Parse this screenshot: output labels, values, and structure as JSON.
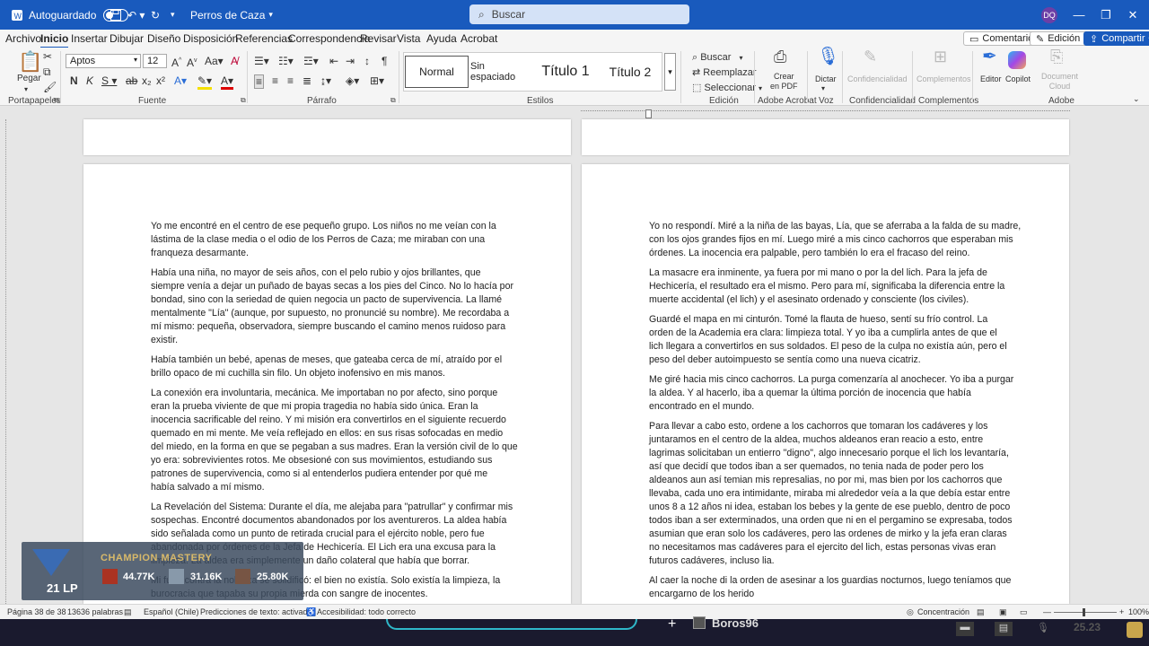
{
  "titlebar": {
    "autosave_label": "Autoguardado",
    "doc_title": "Perros de Caza",
    "search_placeholder": "Buscar",
    "user_initials": "DQ"
  },
  "menu": {
    "tabs": [
      "Archivo",
      "Inicio",
      "Insertar",
      "Dibujar",
      "Diseño",
      "Disposición",
      "Referencias",
      "Correspondencia",
      "Revisar",
      "Vista",
      "Ayuda",
      "Acrobat"
    ],
    "comments": "Comentarios",
    "edit_mode": "Edición",
    "share": "Compartir"
  },
  "ribbon": {
    "paste_label": "Pegar",
    "font_name": "Aptos",
    "font_size": "12",
    "styles": [
      "Normal",
      "Sin espaciado",
      "Título 1",
      "Título 2"
    ],
    "find": "Buscar",
    "replace": "Reemplazar",
    "select": "Seleccionar",
    "create_pdf": "Crear en PDF",
    "create_pdf_line1": "Crear",
    "create_pdf_line2": "en PDF",
    "dictate": "Dictar",
    "confidentiality": "Confidencialidad",
    "complements": "Complementos",
    "editor": "Editor",
    "copilot": "Copilot",
    "cloud_doc_line1": "Document",
    "cloud_doc_line2": "Cloud",
    "groups": {
      "clipboard": "Portapapeles",
      "font": "Fuente",
      "paragraph": "Párrafo",
      "styles": "Estilos",
      "editing": "Edición",
      "adobe": "Adobe Acrobat",
      "voice": "Voz",
      "confidentiality": "Confidencialidad",
      "complements": "Complementos",
      "adobe2": "Adobe"
    }
  },
  "left_page": {
    "paragraphs": [
      [
        "Yo me encontré en el centro de ese pequeño grupo. Los niños no me veían con la",
        "lástima de la clase media o el odio de los Perros de Caza; me miraban con una",
        "franqueza desarmante."
      ],
      [
        "Había una niña, no mayor de seis años, con el pelo rubio y ojos brillantes, que",
        "siempre venía a dejar un puñado de bayas secas a los pies del Cinco. No lo hacía por",
        "bondad, sino con la seriedad de quien negocia un pacto de supervivencia. La llamé",
        "mentalmente \"Lía\" (aunque, por supuesto, no pronuncié su nombre). Me recordaba a",
        "mí mismo: pequeña, observadora, siempre buscando el camino menos ruidoso para",
        "existir."
      ],
      [
        "Había también un bebé, apenas de meses, que gateaba cerca de mí, atraído por el",
        "brillo opaco de mi cuchilla sin filo. Un objeto inofensivo en mis manos."
      ],
      [
        "La conexión era involuntaria, mecánica. Me importaban no por afecto, sino porque",
        "eran la prueba viviente de que mi propia tragedia no había sido única. Eran la",
        "inocencia sacrificable del reino. Y mi misión era convertirlos en el siguiente recuerdo",
        "quemado en mi mente. Me veía reflejado en ellos: en sus risas sofocadas en medio",
        "del miedo, en la forma en que se pegaban a sus madres. Eran la versión civil de lo que",
        "yo era: sobrevivientes rotos. Me obsesioné con sus movimientos, estudiando sus",
        "patrones de supervivencia, como si al entenderlos pudiera entender por qué me",
        "había salvado a mí mismo."
      ],
      [
        "La Revelación del Sistema: Durante el día, me alejaba para \"patrullar\" y confirmar mis",
        "sospechas. Encontré documentos abandonados por los aventureros. La aldea había",
        "sido señalada como un punto de retirada crucial para el ejército noble, pero fue",
        "abandonada por órdenes de la Jefa de Hechicería. El Lich era una excusa para la",
        "limpieza. La aldea era simplemente un daño colateral que había que borrar."
      ],
      [
        "Mi furia contra la nobleza se solidificó: el bien no existía. Solo existía la limpieza, la",
        "burocracia que tapaba su propia mierda con sangre de inocentes."
      ]
    ]
  },
  "right_page": {
    "paragraphs": [
      [
        "Yo no respondí. Miré a la niña de las bayas, Lía, que se aferraba a la falda de su madre,",
        "con los ojos grandes fijos en mí. Luego miré a mis cinco cachorros que esperaban mis",
        "órdenes. La inocencia era palpable, pero también lo era el fracaso del reino."
      ],
      [
        "La masacre era inminente, ya fuera por mi mano o por la del lich. Para la jefa de",
        "Hechicería, el resultado era el mismo. Pero para mí, significaba la diferencia entre la",
        "muerte accidental (el lich) y el asesinato ordenado y consciente (los civiles)."
      ],
      [
        "Guardé el mapa en mi cinturón. Tomé la flauta de hueso, sentí su frío control. La",
        "orden de la Academia era clara: limpieza total. Y yo iba a cumplirla antes de que el",
        "lich llegara a convertirlos en sus soldados. El peso de la culpa no existía aún, pero el",
        "peso del deber autoimpuesto se sentía como una nueva cicatriz."
      ],
      [
        "Me giré hacia mis cinco cachorros. La purga comenzaría al anochecer. Yo iba a purgar",
        "la aldea. Y al hacerlo, iba a quemar la última porción de inocencia que había",
        "encontrado en el mundo."
      ],
      [
        "Para llevar a cabo esto, ordene a los cachorros que tomaran los cadáveres y los",
        "juntaramos en el centro de la aldea, muchos aldeanos eran reacio a esto, entre",
        "lagrimas solicitaban un entierro \"digno\", algo innecesario porque el lich los levantaría,",
        "así que decidí que todos iban a ser quemados, no tenia nada de poder pero los",
        "aldeanos aun así temian mis represalias, no por mi, mas bien por los cachorros que",
        "llevaba, cada uno era intimidante, miraba mi alrededor veía a la que debía estar entre",
        "unos 8 a 12 años ni idea, estaban los bebes y la gente de ese pueblo, dentro de poco",
        "todos iban a ser exterminados, una orden que ni en el pergamino se expresaba, todos",
        "asumian que eran solo los cadáveres, pero las ordenes de mirko y la jefa eran claras",
        "no necesitamos mas cadáveres para el ejercito del lich, estas personas vivas eran",
        "futuros cadáveres, incluso lia."
      ],
      [
        "Al caer la noche di la orden de asesinar a los guardias nocturnos, luego teníamos que",
        "encargarno de los herido"
      ]
    ]
  },
  "overlay": {
    "title": "CHAMPION MASTERY",
    "lp": "21 LP",
    "scores": [
      "44.77K",
      "31.16K",
      "25.80K"
    ]
  },
  "statusbar": {
    "page": "Página 38 de 38",
    "words": "13636 palabras",
    "language": "Español (Chile)",
    "predictions": "Predicciones de texto: activado",
    "accessibility": "Accesibilidad: todo correcto",
    "focus": "Concentración",
    "zoom": "100%"
  },
  "taskbar": {
    "name": "Boros96",
    "time": "25.23"
  }
}
